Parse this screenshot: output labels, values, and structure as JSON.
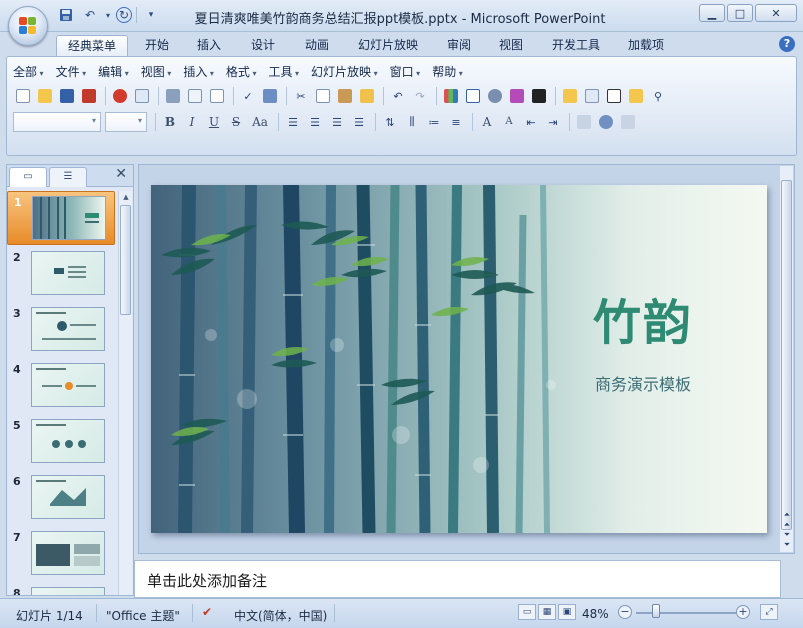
{
  "window": {
    "title": "夏日清爽唯美竹韵商务总结汇报ppt模板.pptx - Microsoft PowerPoint",
    "controls": {
      "minimize": "▁",
      "maximize": "□",
      "close": "✕"
    }
  },
  "ribbon_tabs": [
    "经典菜单",
    "开始",
    "插入",
    "设计",
    "动画",
    "幻灯片放映",
    "审阅",
    "视图",
    "开发工具",
    "加载项"
  ],
  "active_tab": "经典菜单",
  "menu": [
    "全部",
    "文件",
    "编辑",
    "视图",
    "插入",
    "格式",
    "工具",
    "幻灯片放映",
    "窗口",
    "帮助"
  ],
  "format_buttons": {
    "bold": "B",
    "italic": "I",
    "underline": "U",
    "strike": "S",
    "case": "Aa",
    "font_grow": "A",
    "font_shrink": "A"
  },
  "slide_pane": {
    "slides": [
      {
        "num": "1"
      },
      {
        "num": "2"
      },
      {
        "num": "3"
      },
      {
        "num": "4"
      },
      {
        "num": "5"
      },
      {
        "num": "6"
      },
      {
        "num": "7"
      },
      {
        "num": "8"
      }
    ],
    "selected": "1"
  },
  "slide": {
    "title": "竹韵",
    "subtitle": "商务演示模板"
  },
  "notes": {
    "placeholder": "单击此处添加备注"
  },
  "statusbar": {
    "slide_info": "幻灯片 1/14",
    "theme": "\"Office 主题\"",
    "language": "中文(简体，中国)",
    "zoom": "48%"
  },
  "colors": {
    "accent_orange": "#e88b2a",
    "title_green": "#2f8a73",
    "ribbon_blue": "#cfdcee"
  }
}
